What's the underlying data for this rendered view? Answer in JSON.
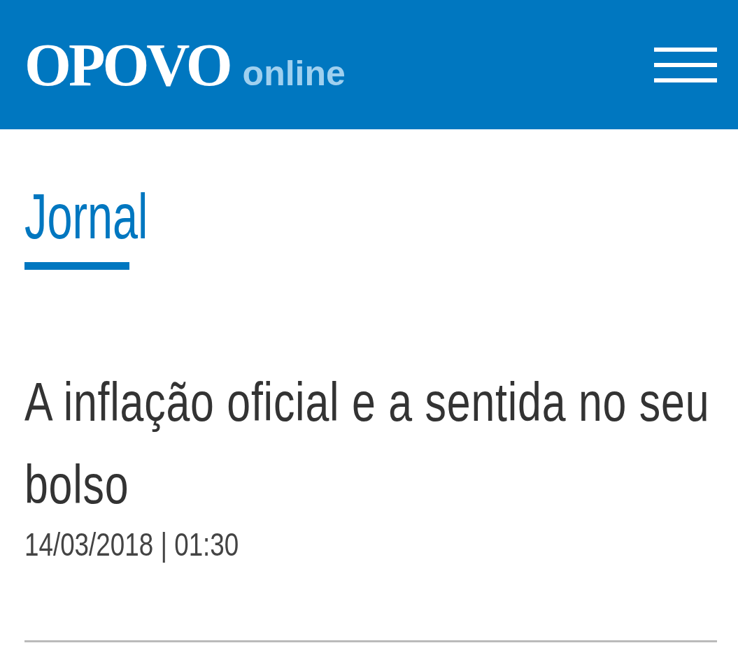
{
  "header": {
    "logo": {
      "name": "OPOVO",
      "suffix": "online"
    }
  },
  "section": {
    "title": "Jornal"
  },
  "article": {
    "headline": "A inflação oficial e a sentida no seu bolso",
    "date": "14/03/2018 | 01:30"
  }
}
